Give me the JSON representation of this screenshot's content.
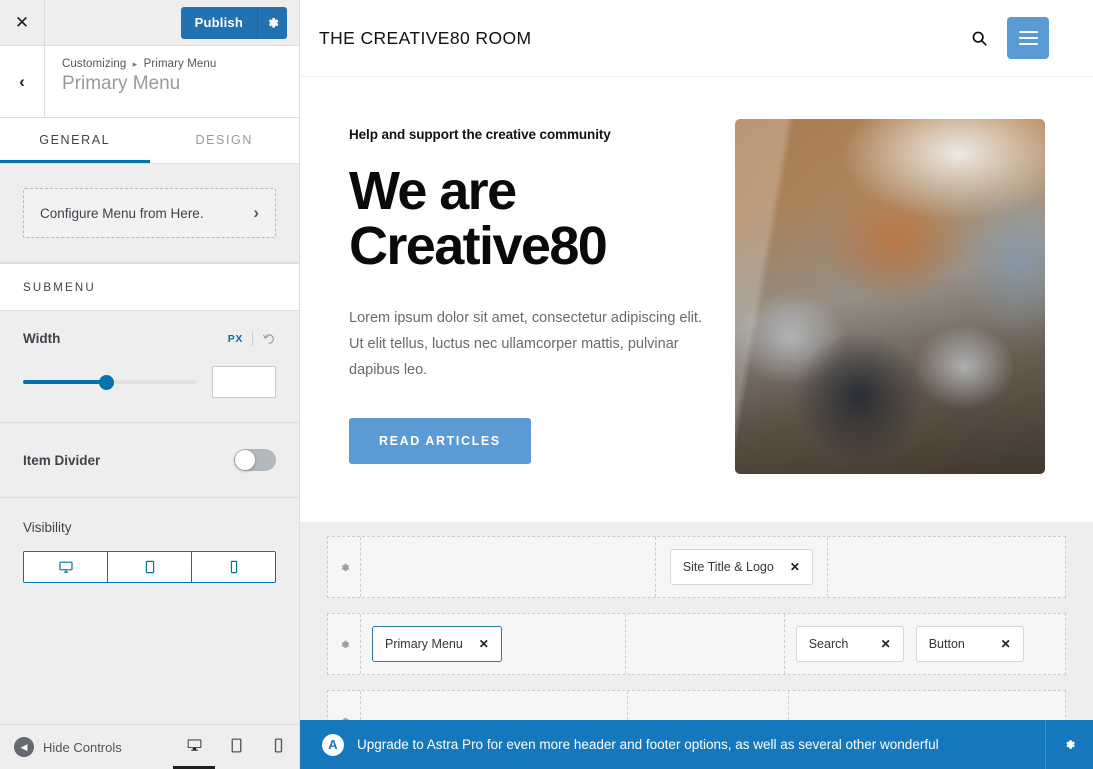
{
  "sidebar": {
    "close_label": "✕",
    "publish": {
      "label": "Publish",
      "gear_icon": "gear-icon"
    },
    "back_label": "‹",
    "breadcrumb": {
      "root": "Customizing",
      "separator": "▸",
      "current": "Primary Menu"
    },
    "panel_title": "Primary Menu",
    "tabs": [
      {
        "label": "GENERAL",
        "active": true
      },
      {
        "label": "DESIGN",
        "active": false
      }
    ],
    "configure": {
      "label": "Configure Menu from Here.",
      "chevron": "›"
    },
    "submenu_section": "SUBMENU",
    "width_control": {
      "label": "Width",
      "unit": "PX",
      "value": "",
      "placeholder": "",
      "slider_percent": 48,
      "reset_icon": "reset-icon"
    },
    "item_divider": {
      "label": "Item Divider",
      "state": "off"
    },
    "visibility": {
      "label": "Visibility",
      "options": [
        {
          "icon": "desktop-icon",
          "active": true
        },
        {
          "icon": "tablet-icon",
          "active": false
        },
        {
          "icon": "mobile-icon",
          "active": false
        }
      ]
    },
    "footer": {
      "hide_controls_label": "Hide Controls",
      "devices": [
        {
          "icon": "desktop-preview-icon",
          "active": true
        },
        {
          "icon": "tablet-preview-icon",
          "active": false
        },
        {
          "icon": "mobile-preview-icon",
          "active": false
        }
      ]
    }
  },
  "preview": {
    "site_header": {
      "title": "THE CREATIVE80 ROOM",
      "search_icon": "search-icon",
      "menu_icon": "hamburger-icon"
    },
    "hero": {
      "eyebrow": "Help and support the creative community",
      "title_line1": "We are",
      "title_line2": "Creative80",
      "description": "Lorem ipsum dolor sit amet, consectetur adipiscing elit. Ut elit tellus, luctus nec ullamcorper mattis, pulvinar dapibus leo.",
      "button_label": "READ ARTICLES",
      "image_alt": "team-collaborating-photo"
    },
    "header_builder": {
      "rows": [
        {
          "gear_icon": "gear-icon",
          "left": [],
          "center": [
            {
              "label": "Site Title & Logo",
              "selected": false,
              "close": "✕"
            }
          ],
          "right": []
        },
        {
          "gear_icon": "gear-icon",
          "left": [
            {
              "label": "Primary Menu",
              "selected": true,
              "close": "✕"
            }
          ],
          "center": [],
          "right": [
            {
              "label": "Search",
              "selected": false,
              "close": "✕"
            },
            {
              "label": "Button",
              "selected": false,
              "close": "✕"
            }
          ]
        },
        {
          "gear_icon": "gear-icon",
          "left": [],
          "center": [],
          "right": []
        }
      ]
    },
    "notice": {
      "logo": "A",
      "text": "Upgrade to Astra Pro for even more header and footer options, as well as several other wonderful",
      "gear_icon": "gear-icon"
    }
  },
  "colors": {
    "wp_blue": "#2271b1",
    "accent_blue": "#0073aa",
    "theme_blue": "#5b9bd5",
    "notice_blue": "#1578bc",
    "sidebar_bg": "#eeeeee"
  }
}
